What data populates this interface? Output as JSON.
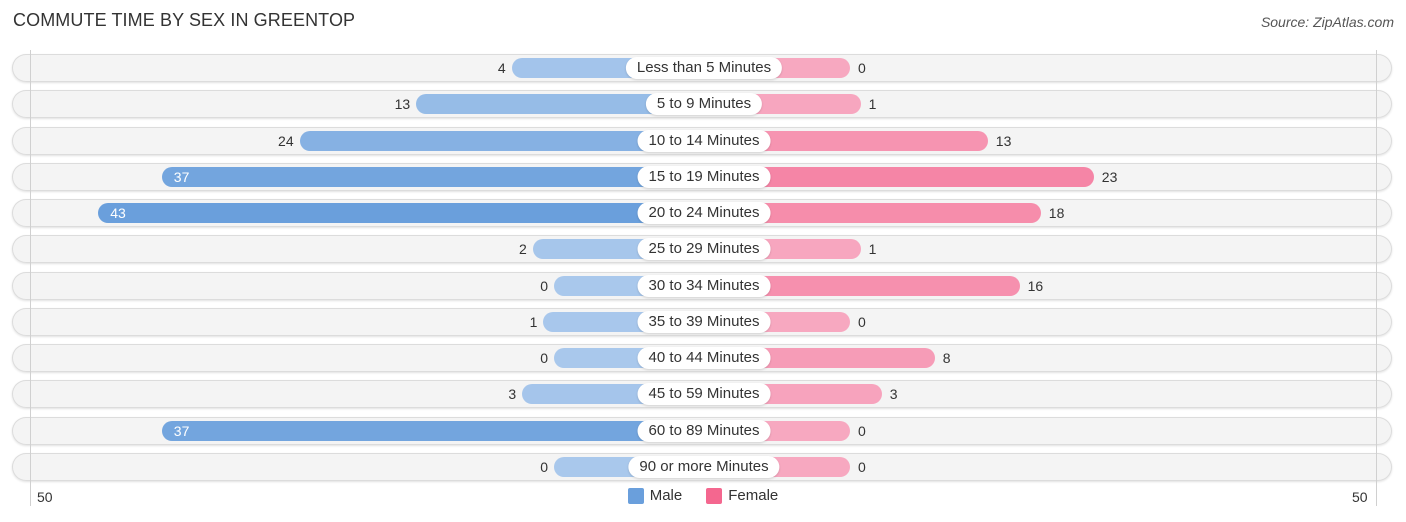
{
  "header": {
    "title": "COMMUTE TIME BY SEX IN GREENTOP",
    "source": "Source: ZipAtlas.com"
  },
  "colors": {
    "male_strong": "#6a9fdc",
    "male_light": "#a9c8ec",
    "female_strong": "#f4678f",
    "female_light": "#f7a8c0"
  },
  "chart_data": {
    "type": "bar",
    "orientation": "horizontal-diverging",
    "title": "COMMUTE TIME BY SEX IN GREENTOP",
    "categories": [
      "Less than 5 Minutes",
      "5 to 9 Minutes",
      "10 to 14 Minutes",
      "15 to 19 Minutes",
      "20 to 24 Minutes",
      "25 to 29 Minutes",
      "30 to 34 Minutes",
      "35 to 39 Minutes",
      "40 to 44 Minutes",
      "45 to 59 Minutes",
      "60 to 89 Minutes",
      "90 or more Minutes"
    ],
    "series": [
      {
        "name": "Male",
        "values": [
          4,
          13,
          24,
          37,
          43,
          2,
          0,
          1,
          0,
          3,
          37,
          0
        ]
      },
      {
        "name": "Female",
        "values": [
          0,
          1,
          13,
          23,
          18,
          1,
          16,
          0,
          8,
          3,
          0,
          0
        ]
      }
    ],
    "axis": {
      "left_tick": "50",
      "right_tick": "50",
      "range": [
        0,
        50
      ]
    },
    "legend": {
      "position": "bottom-center",
      "entries": [
        "Male",
        "Female"
      ]
    },
    "grid": false
  }
}
